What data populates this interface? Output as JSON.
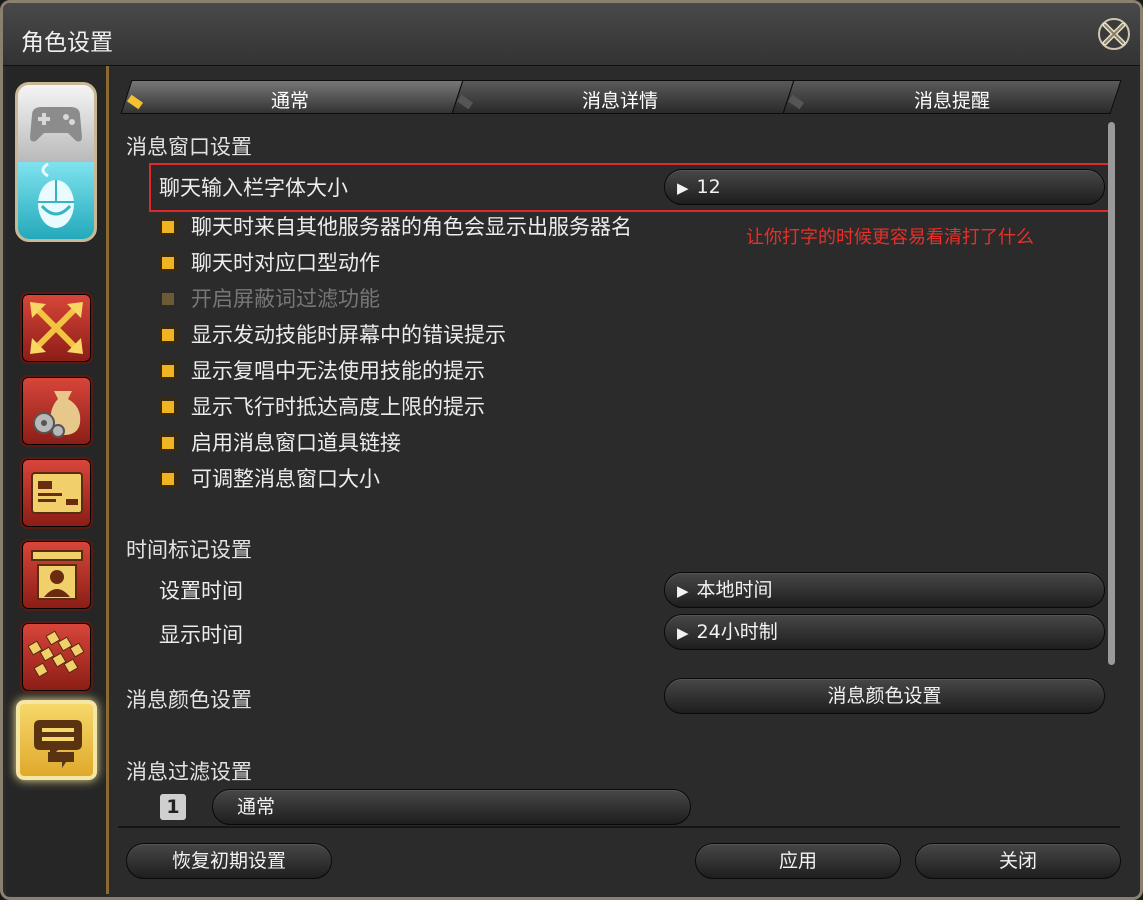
{
  "window": {
    "title": "角色设置"
  },
  "tabs": [
    {
      "label": "通常",
      "active": true
    },
    {
      "label": "消息详情",
      "active": false
    },
    {
      "label": "消息提醒",
      "active": false
    }
  ],
  "message_window": {
    "section_title": "消息窗口设置",
    "font_size_label": "聊天输入栏字体大小",
    "font_size_value": "12",
    "annotation": "让你打字的时候更容易看清打了什么",
    "options": [
      {
        "label": "聊天时来自其他服务器的角色会显示出服务器名",
        "checked": true,
        "disabled": false
      },
      {
        "label": "聊天时对应口型动作",
        "checked": true,
        "disabled": false
      },
      {
        "label": "开启屏蔽词过滤功能",
        "checked": true,
        "disabled": true
      },
      {
        "label": "显示发动技能时屏幕中的错误提示",
        "checked": true,
        "disabled": false
      },
      {
        "label": "显示复唱中无法使用技能的提示",
        "checked": true,
        "disabled": false
      },
      {
        "label": "显示飞行时抵达高度上限的提示",
        "checked": true,
        "disabled": false
      },
      {
        "label": "启用消息窗口道具链接",
        "checked": true,
        "disabled": false
      },
      {
        "label": "可调整消息窗口大小",
        "checked": true,
        "disabled": false
      }
    ]
  },
  "timestamp": {
    "section_title": "时间标记设置",
    "set_time_label": "设置时间",
    "set_time_value": "本地时间",
    "display_time_label": "显示时间",
    "display_time_value": "24小时制"
  },
  "message_color": {
    "section_title": "消息颜色设置",
    "button_label": "消息颜色设置"
  },
  "message_filter": {
    "section_title": "消息过滤设置",
    "index": "1",
    "value": "通常"
  },
  "footer": {
    "reset_label": "恢复初期设置",
    "apply_label": "应用",
    "close_label": "关闭"
  },
  "colors": {
    "accent": "#f0b321",
    "highlight_border": "#e02a2a",
    "annotation_text": "#e8302a"
  },
  "icons": {
    "close": "close-x-icon",
    "device_top": "gamepad-icon",
    "device_bottom": "mouse-icon",
    "categories": [
      "arrows-icon",
      "bag-gears-icon",
      "card-icon",
      "profile-icon",
      "checker-icon",
      "chat-bubbles-icon"
    ]
  }
}
